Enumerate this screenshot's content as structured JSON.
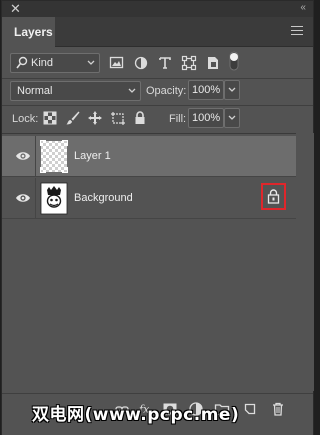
{
  "panel": {
    "close_glyph": "✕",
    "collapse_glyph": "‹‹",
    "tab_label": "Layers",
    "menu_icon": "hamburger-menu-icon"
  },
  "filter": {
    "kind_label": "Kind",
    "icons": [
      "pixel-layer-filter-icon",
      "adjustment-layer-filter-icon",
      "type-layer-filter-icon",
      "shape-layer-filter-icon",
      "smart-object-filter-icon"
    ]
  },
  "blending": {
    "mode": "Normal",
    "opacity_label": "Opacity:",
    "opacity_value": "100%"
  },
  "lock": {
    "label": "Lock:",
    "icons": [
      "lock-transparent-pixels-icon",
      "lock-image-pixels-icon",
      "lock-position-icon",
      "prevent-auto-nesting-icon",
      "lock-all-icon"
    ],
    "fill_label": "Fill:",
    "fill_value": "100%"
  },
  "layers": [
    {
      "name": "Layer 1",
      "selected": true,
      "visible": true,
      "locked": false
    },
    {
      "name": "Background",
      "selected": false,
      "visible": true,
      "locked": true
    }
  ],
  "bottom_icons": [
    "link-layers-icon",
    "layer-style-fx-icon",
    "add-mask-icon",
    "adjustment-layer-icon",
    "new-group-icon",
    "new-layer-icon",
    "delete-layer-icon"
  ],
  "watermark": "双电网(www.pcpc.me)",
  "colors": {
    "panel_bg": "#535353",
    "selected_row": "#6d6d6d",
    "highlight_red": "#e0262b"
  }
}
